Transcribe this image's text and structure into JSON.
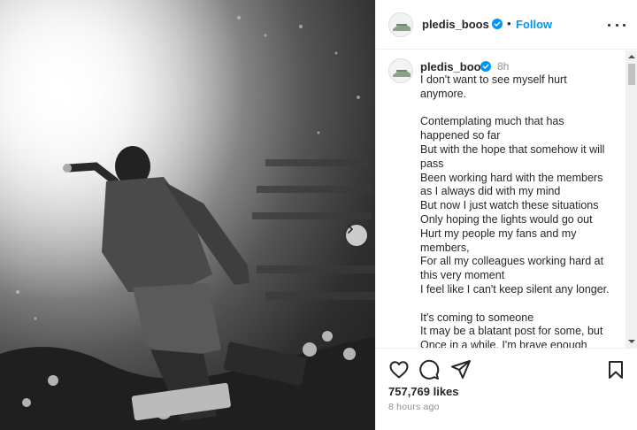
{
  "post": {
    "username": "pledis_boos",
    "follow_label": "Follow",
    "separator": "•",
    "relative_time": "8h",
    "caption_lines": [
      "I don't want to see myself hurt",
      "anymore.",
      "",
      "Contemplating much that has",
      "happened so far",
      "But with the hope that somehow it will",
      "pass",
      "Been working hard with the members",
      "as I always did with my mind",
      "But now I just watch these situations",
      "Only hoping the lights would go out",
      "Hurt my people my fans and my",
      "members,",
      "For all my colleagues working hard at",
      "this very moment",
      "I feel like I can't keep silent any longer.",
      "",
      "It's coming to someone",
      "It may be a blatant post for some, but",
      "Once in a while, I'm brave enough"
    ],
    "likes": "757,769 likes",
    "posted_ago": "8 hours ago"
  },
  "icons": {
    "verified": "verified-badge-icon",
    "more": "more-options-icon",
    "like": "heart-icon",
    "comment": "comment-bubble-icon",
    "share": "paper-plane-icon",
    "save": "bookmark-icon",
    "next": "chevron-right-icon"
  },
  "colors": {
    "accent": "#0095f6",
    "text": "#262626",
    "muted": "#8e8e8e"
  }
}
